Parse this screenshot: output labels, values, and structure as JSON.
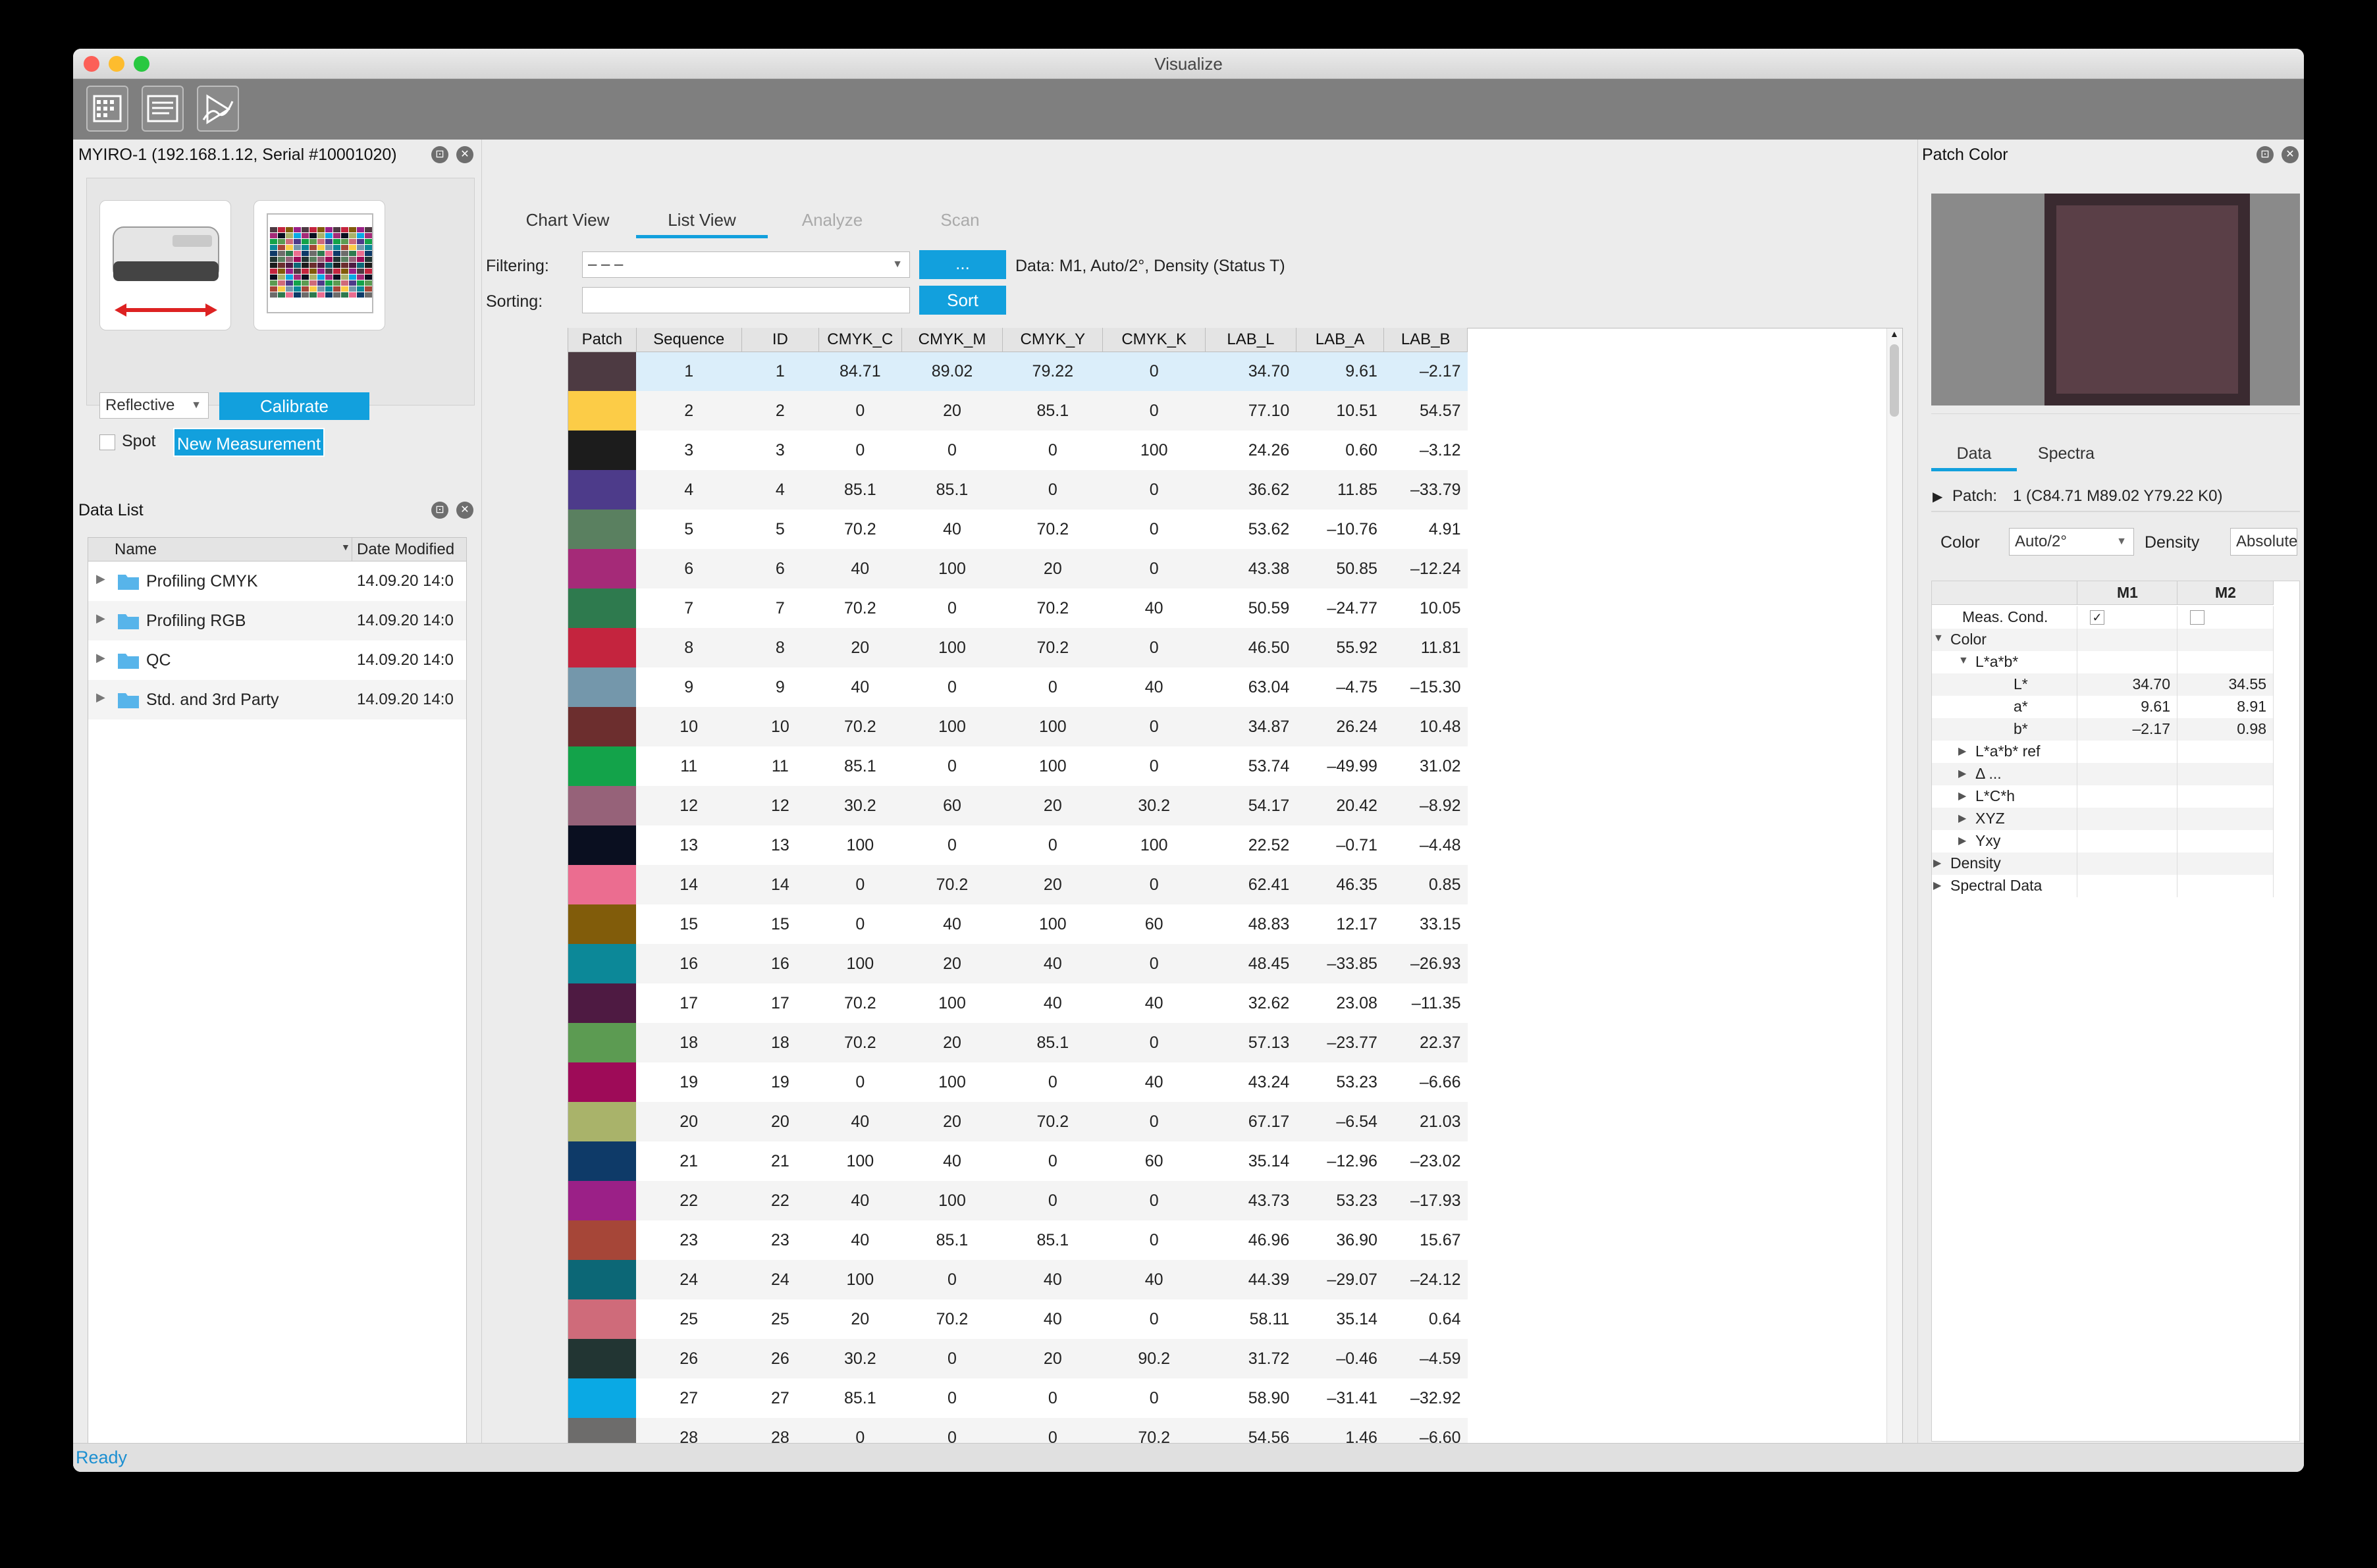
{
  "window": {
    "title": "Visualize"
  },
  "colors": {
    "accent": "#12a0dd",
    "toolbar": "#7f7f7f",
    "status_text": "#1b8fd1"
  },
  "toolbar": {
    "icons": [
      "chart-icon",
      "list-icon",
      "analyze-icon"
    ]
  },
  "device_panel": {
    "title": "MYIRO-1 (192.168.1.12, Serial #10001020)",
    "mode_value": "Reflective",
    "calibrate_label": "Calibrate",
    "spot_label": "Spot",
    "new_measurement_label": "New Measurement"
  },
  "data_list": {
    "title": "Data List",
    "col_name": "Name",
    "col_date": "Date Modified",
    "items": [
      {
        "name": "Profiling CMYK",
        "date": "14.09.20 14:0"
      },
      {
        "name": "Profiling RGB",
        "date": "14.09.20 14:0"
      },
      {
        "name": "QC",
        "date": "14.09.20 14:0"
      },
      {
        "name": "Std. and 3rd Party",
        "date": "14.09.20 14:0"
      }
    ]
  },
  "center": {
    "tabs": [
      "Chart View",
      "List View",
      "Analyze",
      "Scan"
    ],
    "filtering_label": "Filtering:",
    "filter_value": "– – –",
    "dots_label": "...",
    "data_info": "Data: M1, Auto/2°, Density (Status T)",
    "sorting_label": "Sorting:",
    "sort_value": "",
    "sort_button": "Sort",
    "columns": [
      "Patch",
      "Sequence",
      "ID",
      "CMYK_C",
      "CMYK_M",
      "CMYK_Y",
      "CMYK_K",
      "LAB_L",
      "LAB_A",
      "LAB_B"
    ],
    "rows": [
      {
        "color": "#4d3a42",
        "seq": "1",
        "id": "1",
        "c": "84.71",
        "m": "89.02",
        "y": "79.22",
        "k": "0",
        "l": "34.70",
        "a": "9.61",
        "b": "–2.17"
      },
      {
        "color": "#fccc47",
        "seq": "2",
        "id": "2",
        "c": "0",
        "m": "20",
        "y": "85.1",
        "k": "0",
        "l": "77.10",
        "a": "10.51",
        "b": "54.57"
      },
      {
        "color": "#1c1c1c",
        "seq": "3",
        "id": "3",
        "c": "0",
        "m": "0",
        "y": "0",
        "k": "100",
        "l": "24.26",
        "a": "0.60",
        "b": "–3.12"
      },
      {
        "color": "#4d3b8a",
        "seq": "4",
        "id": "4",
        "c": "85.1",
        "m": "85.1",
        "y": "0",
        "k": "0",
        "l": "36.62",
        "a": "11.85",
        "b": "–33.79"
      },
      {
        "color": "#5a8060",
        "seq": "5",
        "id": "5",
        "c": "70.2",
        "m": "40",
        "y": "70.2",
        "k": "0",
        "l": "53.62",
        "a": "–10.76",
        "b": "4.91"
      },
      {
        "color": "#a52a78",
        "seq": "6",
        "id": "6",
        "c": "40",
        "m": "100",
        "y": "20",
        "k": "0",
        "l": "43.38",
        "a": "50.85",
        "b": "–12.24"
      },
      {
        "color": "#2e7a4e",
        "seq": "7",
        "id": "7",
        "c": "70.2",
        "m": "0",
        "y": "70.2",
        "k": "40",
        "l": "50.59",
        "a": "–24.77",
        "b": "10.05"
      },
      {
        "color": "#c4243e",
        "seq": "8",
        "id": "8",
        "c": "20",
        "m": "100",
        "y": "70.2",
        "k": "0",
        "l": "46.50",
        "a": "55.92",
        "b": "11.81"
      },
      {
        "color": "#7497ab",
        "seq": "9",
        "id": "9",
        "c": "40",
        "m": "0",
        "y": "0",
        "k": "40",
        "l": "63.04",
        "a": "–4.75",
        "b": "–15.30"
      },
      {
        "color": "#6c2e2e",
        "seq": "10",
        "id": "10",
        "c": "70.2",
        "m": "100",
        "y": "100",
        "k": "0",
        "l": "34.87",
        "a": "26.24",
        "b": "10.48"
      },
      {
        "color": "#13a34a",
        "seq": "11",
        "id": "11",
        "c": "85.1",
        "m": "0",
        "y": "100",
        "k": "0",
        "l": "53.74",
        "a": "–49.99",
        "b": "31.02"
      },
      {
        "color": "#966279",
        "seq": "12",
        "id": "12",
        "c": "30.2",
        "m": "60",
        "y": "20",
        "k": "30.2",
        "l": "54.17",
        "a": "20.42",
        "b": "–8.92"
      },
      {
        "color": "#0a0f20",
        "seq": "13",
        "id": "13",
        "c": "100",
        "m": "0",
        "y": "0",
        "k": "100",
        "l": "22.52",
        "a": "–0.71",
        "b": "–4.48"
      },
      {
        "color": "#eb6d90",
        "seq": "14",
        "id": "14",
        "c": "0",
        "m": "70.2",
        "y": "20",
        "k": "0",
        "l": "62.41",
        "a": "46.35",
        "b": "0.85"
      },
      {
        "color": "#815c0a",
        "seq": "15",
        "id": "15",
        "c": "0",
        "m": "40",
        "y": "100",
        "k": "60",
        "l": "48.83",
        "a": "12.17",
        "b": "33.15"
      },
      {
        "color": "#0c8898",
        "seq": "16",
        "id": "16",
        "c": "100",
        "m": "20",
        "y": "40",
        "k": "0",
        "l": "48.45",
        "a": "–33.85",
        "b": "–26.93"
      },
      {
        "color": "#4e1a42",
        "seq": "17",
        "id": "17",
        "c": "70.2",
        "m": "100",
        "y": "40",
        "k": "40",
        "l": "32.62",
        "a": "23.08",
        "b": "–11.35"
      },
      {
        "color": "#5c9b52",
        "seq": "18",
        "id": "18",
        "c": "70.2",
        "m": "20",
        "y": "85.1",
        "k": "0",
        "l": "57.13",
        "a": "–23.77",
        "b": "22.37"
      },
      {
        "color": "#9e0b58",
        "seq": "19",
        "id": "19",
        "c": "0",
        "m": "100",
        "y": "0",
        "k": "40",
        "l": "43.24",
        "a": "53.23",
        "b": "–6.66"
      },
      {
        "color": "#a9b36a",
        "seq": "20",
        "id": "20",
        "c": "40",
        "m": "20",
        "y": "70.2",
        "k": "0",
        "l": "67.17",
        "a": "–6.54",
        "b": "21.03"
      },
      {
        "color": "#0e3a68",
        "seq": "21",
        "id": "21",
        "c": "100",
        "m": "40",
        "y": "0",
        "k": "60",
        "l": "35.14",
        "a": "–12.96",
        "b": "–23.02"
      },
      {
        "color": "#9b2087",
        "seq": "22",
        "id": "22",
        "c": "40",
        "m": "100",
        "y": "0",
        "k": "0",
        "l": "43.73",
        "a": "53.23",
        "b": "–17.93"
      },
      {
        "color": "#a64638",
        "seq": "23",
        "id": "23",
        "c": "40",
        "m": "85.1",
        "y": "85.1",
        "k": "0",
        "l": "46.96",
        "a": "36.90",
        "b": "15.67"
      },
      {
        "color": "#0c6776",
        "seq": "24",
        "id": "24",
        "c": "100",
        "m": "0",
        "y": "40",
        "k": "40",
        "l": "44.39",
        "a": "–29.07",
        "b": "–24.12"
      },
      {
        "color": "#cf6b7a",
        "seq": "25",
        "id": "25",
        "c": "20",
        "m": "70.2",
        "y": "40",
        "k": "0",
        "l": "58.11",
        "a": "35.14",
        "b": "0.64"
      },
      {
        "color": "#223533",
        "seq": "26",
        "id": "26",
        "c": "30.2",
        "m": "0",
        "y": "20",
        "k": "90.2",
        "l": "31.72",
        "a": "–0.46",
        "b": "–4.59"
      },
      {
        "color": "#0aa9e4",
        "seq": "27",
        "id": "27",
        "c": "85.1",
        "m": "0",
        "y": "0",
        "k": "0",
        "l": "58.90",
        "a": "–31.41",
        "b": "–32.92"
      },
      {
        "color": "#6d6c6b",
        "seq": "28",
        "id": "28",
        "c": "0",
        "m": "0",
        "y": "0",
        "k": "70.2",
        "l": "54.56",
        "a": "1.46",
        "b": "–6.60"
      }
    ]
  },
  "patch_panel": {
    "title": "Patch Color",
    "patch_color": "#5a3f47",
    "tabs": [
      "Data",
      "Spectra"
    ],
    "patch_label": "Patch:",
    "patch_value": "1 (C84.71 M89.02 Y79.22 K0)",
    "color_label": "Color",
    "color_value": "Auto/2°",
    "density_label": "Density",
    "density_value": "Absolute",
    "col_m1": "M1",
    "col_m2": "M2",
    "meas_cond": "Meas. Cond.",
    "color_node": "Color",
    "lab_node": "L*a*b*",
    "l_label": "L*",
    "l_m1": "34.70",
    "l_m2": "34.55",
    "a_label": "a*",
    "a_m1": "9.61",
    "a_m2": "8.91",
    "b_label": "b*",
    "b_m1": "–2.17",
    "b_m2": "0.98",
    "lab_ref": "L*a*b* ref",
    "delta": "Δ ...",
    "lch": "L*C*h",
    "xyz": "XYZ",
    "yxy": "Yxy",
    "density_node": "Density",
    "spectral_node": "Spectral Data"
  },
  "status": {
    "text": "Ready"
  }
}
